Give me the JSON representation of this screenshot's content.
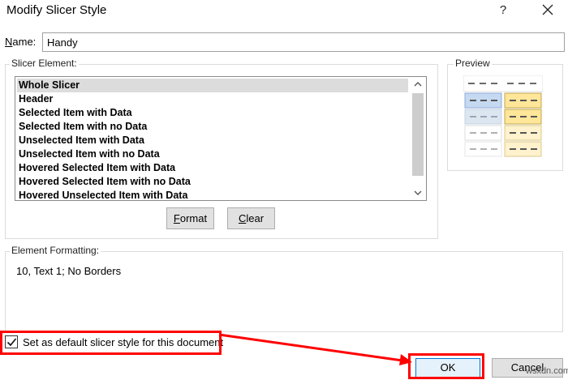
{
  "dialog": {
    "title": "Modify Slicer Style",
    "help": "?",
    "close_icon": "close-icon"
  },
  "name": {
    "label_prefix": "N",
    "label_rest": "ame:",
    "value": "Handy"
  },
  "slicer_element": {
    "label": "Slicer Element:",
    "items": [
      "Whole Slicer",
      "Header",
      "Selected Item with Data",
      "Selected Item with no Data",
      "Unselected Item with Data",
      "Unselected Item with no Data",
      "Hovered Selected Item with Data",
      "Hovered Selected Item with no Data",
      "Hovered Unselected Item with Data"
    ],
    "selected_index": 0
  },
  "buttons": {
    "format": "Format",
    "clear": "Clear",
    "ok": "OK",
    "cancel": "Cancel"
  },
  "preview": {
    "label": "Preview",
    "colors": {
      "blue": "#c5d9f1",
      "yellow": "#ffe699",
      "light_blue": "#dce6f1",
      "light_yellow": "#fff2cc"
    }
  },
  "element_formatting": {
    "label": "Element Formatting:",
    "text": "10, Text 1; No Borders"
  },
  "default_checkbox": {
    "checked": true,
    "label_prefix": "Set as default slicer style for this document"
  },
  "highlight_color": "#ff0000",
  "watermark": "wsxdn.com"
}
